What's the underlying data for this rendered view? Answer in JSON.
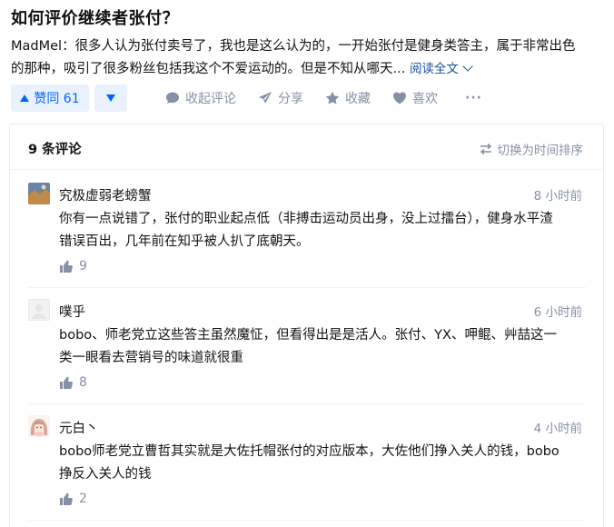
{
  "question": {
    "title": "如何评价继续者张付？"
  },
  "answer": {
    "author": "MadMel",
    "author_sep": "：",
    "excerpt_line1": "很多人认为张付卖号了，我也是这么认为的，一开始张付是健身类答主，属于非常出色",
    "excerpt_line2": "的那种，吸引了很多粉丝包括我这个不爱运动的。但是不知从哪天...",
    "read_more": "阅读全文"
  },
  "actions": {
    "upvote_label": "赞同 61",
    "collapse_comments": "收起评论",
    "share": "分享",
    "collect": "收藏",
    "like": "喜欢",
    "more": "···"
  },
  "comments": {
    "count_label": "9 条评论",
    "sort_label": "切换为时间排序",
    "items": [
      {
        "name": "究极虚弱老螃蟹",
        "time": "8 小时前",
        "line1": "你有一点说错了，张付的职业起点低（非搏击运动员出身，没上过擂台），健身水平渣",
        "line2": "错误百出，几年前在知乎被人扒了底朝天。",
        "likes": "9"
      },
      {
        "name": "噗乎",
        "time": "6 小时前",
        "line1": "bobo、师老党立这些答主虽然魔怔，但看得出是是活人。张付、YX、呷鲲、艸喆这一",
        "line2": "类一眼看去营销号的味道就很重",
        "likes": "8"
      },
      {
        "name": "元白丶",
        "time": "4 小时前",
        "line1": "bobo师老党立曹哲其实就是大佐托帽张付的对应版本，大佐他们挣入关人的钱，bobo",
        "line2": "挣反入关人的钱",
        "likes": "2"
      }
    ]
  },
  "colors": {
    "accent": "#0066ff",
    "link": "#175199",
    "muted": "#8590a6"
  }
}
